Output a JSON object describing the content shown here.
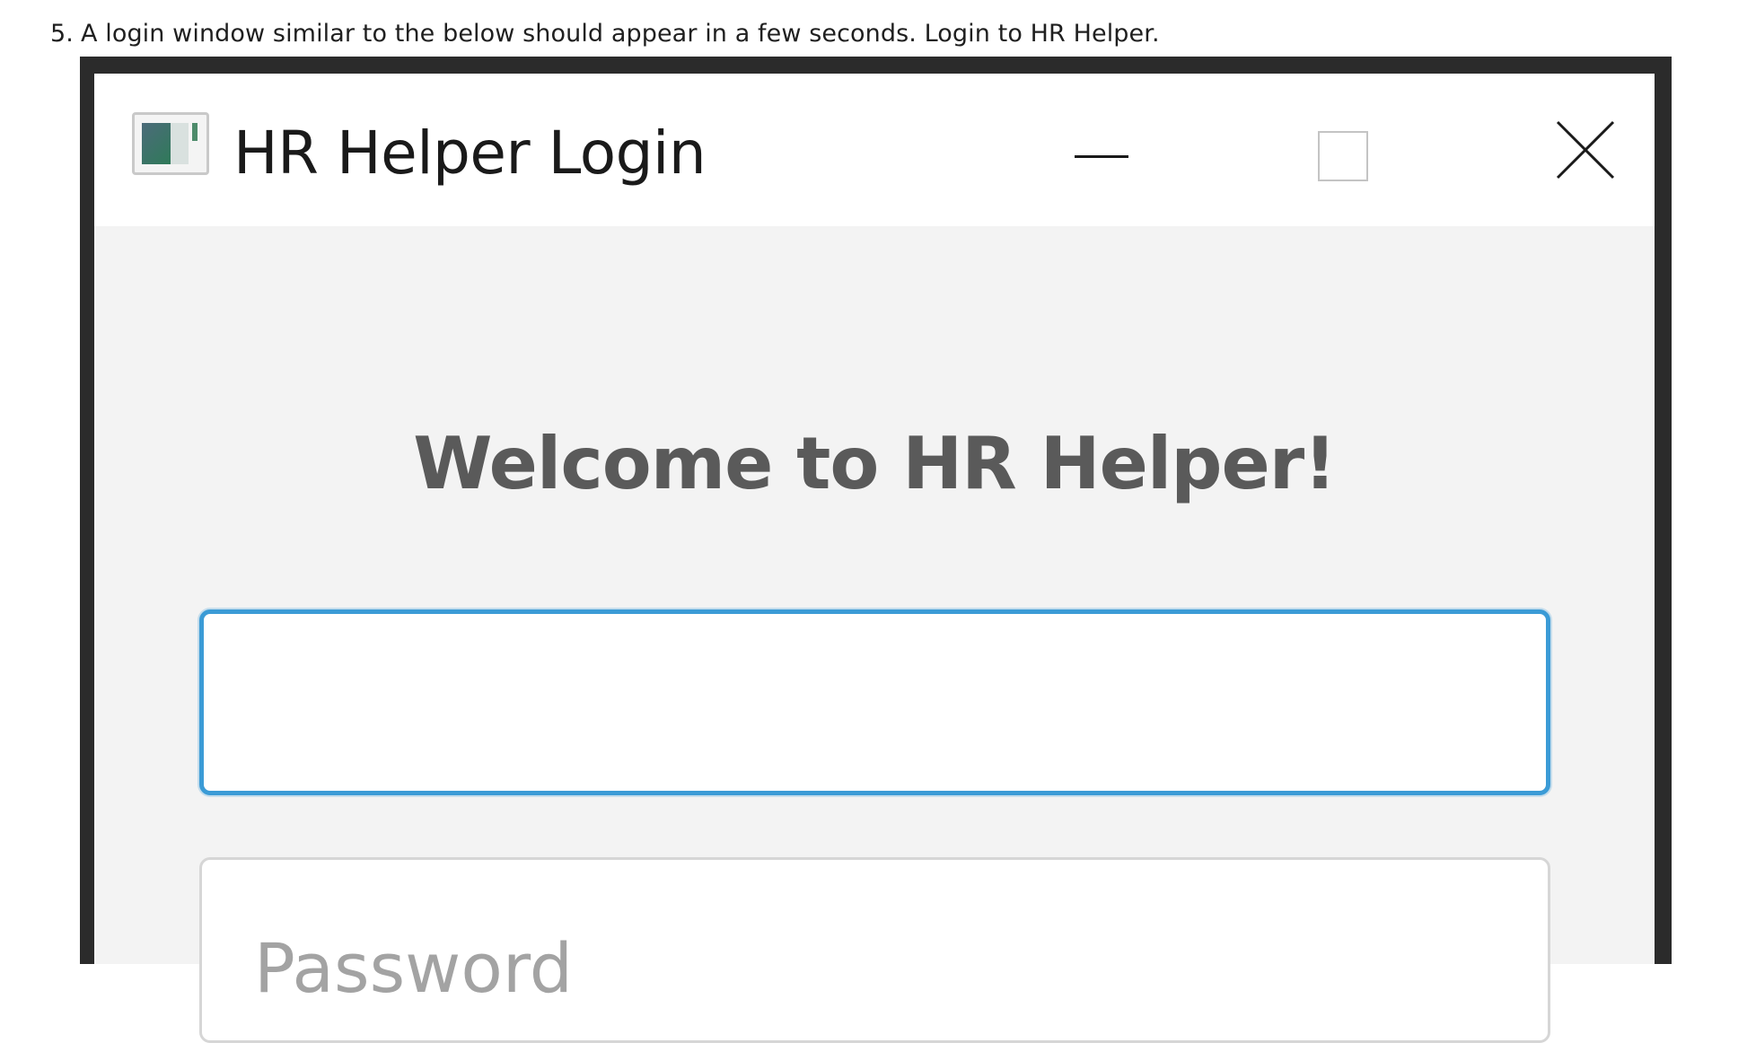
{
  "instruction": {
    "number": "5.",
    "text": "A login window similar to the below should appear in a few seconds. Login to HR Helper."
  },
  "window": {
    "title": "HR Helper Login",
    "icon": "app-window-icon",
    "controls": {
      "minimize": "minimize-icon",
      "maximize": "maximize-icon",
      "close": "close-icon"
    }
  },
  "login": {
    "welcome": "Welcome to HR Helper!",
    "username": {
      "value": "",
      "placeholder": ""
    },
    "password": {
      "value": "",
      "placeholder": "Password"
    }
  },
  "colors": {
    "focus_border": "#3b9bd6",
    "welcome_text": "#5a5a5a",
    "window_bg": "#f3f3f3",
    "frame": "#2b2b2b"
  }
}
